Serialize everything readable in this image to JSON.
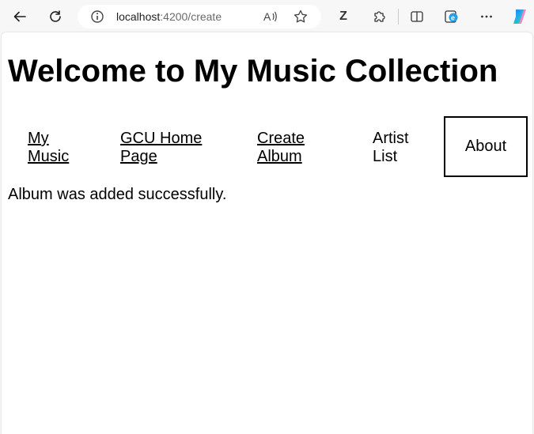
{
  "browser": {
    "url_host": "localhost",
    "url_rest": ":4200/create",
    "extension_letter": "Z"
  },
  "page": {
    "title": "Welcome to My Music Collection",
    "nav": {
      "my_music": [
        "My",
        "Music"
      ],
      "gcu_home": [
        "GCU Home",
        "Page"
      ],
      "create_album": [
        "Create",
        "Album"
      ],
      "artist_list": [
        "Artist",
        "List"
      ],
      "about": "About"
    },
    "status_message": "Album was added successfully."
  },
  "colors": {
    "toolbar_bg": "#f7f7f7",
    "page_bg": "#ffffff",
    "text": "#000000"
  }
}
